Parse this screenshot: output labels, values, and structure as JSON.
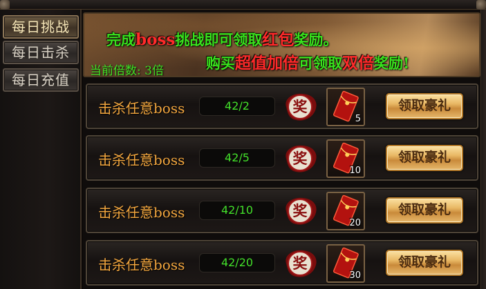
{
  "sidebar": {
    "tabs": [
      {
        "label": "每日挑战",
        "active": true
      },
      {
        "label": "每日击杀",
        "active": false
      },
      {
        "label": "每日充值",
        "active": false
      }
    ]
  },
  "banner": {
    "line1": {
      "p1": "完成",
      "p2": "boss",
      "p3": "挑战即可领取",
      "p4": "红包",
      "p5": "奖励。"
    },
    "line2": {
      "p1": "购买",
      "p2": "超值加倍",
      "p3": "可领取",
      "p4": "双倍",
      "p5": "奖励!"
    },
    "multiplier_label": "当前倍数:",
    "multiplier_value": "3倍"
  },
  "tasks": [
    {
      "label": "击杀任意boss",
      "progress": "42/2",
      "reward_icon": "red-envelope-icon",
      "reward_count": "5",
      "button": "领取豪礼"
    },
    {
      "label": "击杀任意boss",
      "progress": "42/5",
      "reward_icon": "red-envelope-icon",
      "reward_count": "10",
      "button": "领取豪礼"
    },
    {
      "label": "击杀任意boss",
      "progress": "42/10",
      "reward_icon": "red-envelope-icon",
      "reward_count": "20",
      "button": "领取豪礼"
    },
    {
      "label": "击杀任意boss",
      "progress": "42/20",
      "reward_icon": "red-envelope-icon",
      "reward_count": "30",
      "button": "领取豪礼"
    }
  ],
  "reward_badge_char": "奖",
  "colors": {
    "green_text": "#39e21d",
    "red_text": "#ff2a2a",
    "orange_label": "#f2a63e",
    "button_gold": "#e8b764"
  }
}
